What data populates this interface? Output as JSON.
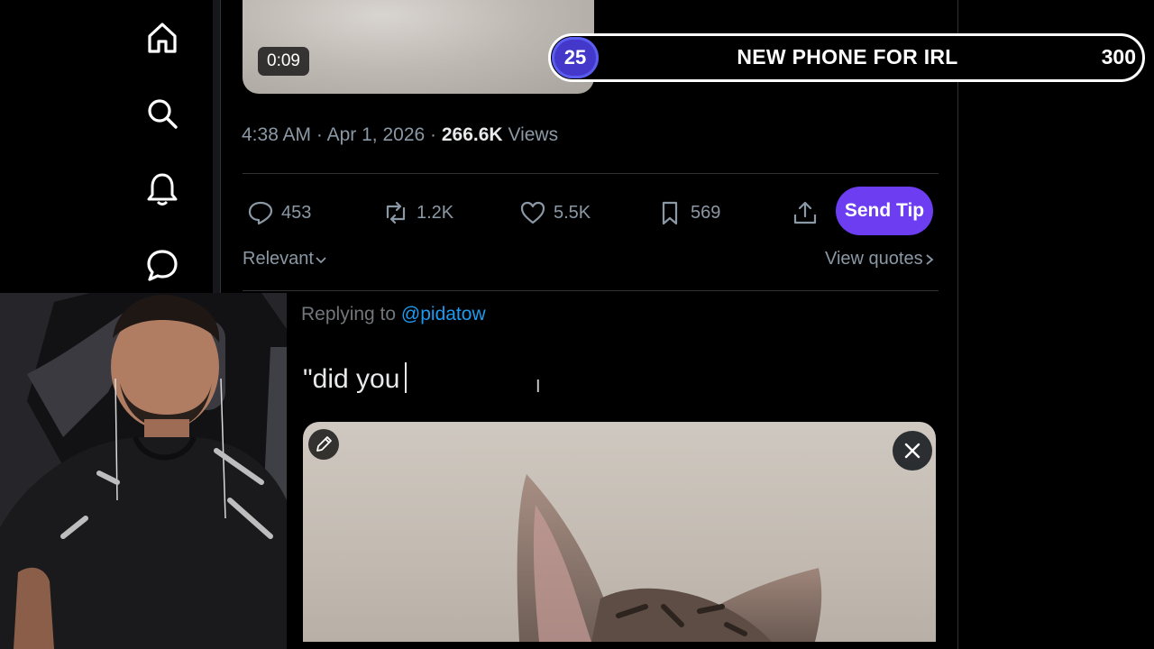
{
  "icons": {
    "home": "home-icon",
    "search": "search-icon",
    "notifications": "bell-icon",
    "messages": "message-icon"
  },
  "video": {
    "duration": "0:09"
  },
  "goal": {
    "count": "25",
    "title": "NEW PHONE FOR IRL",
    "target": "300"
  },
  "tweet": {
    "time": "4:38 AM",
    "date": "Apr 1, 2026",
    "views_count": "266.6K",
    "views_label": "Views",
    "separator": "·"
  },
  "actions": {
    "replies": "453",
    "reposts": "1.2K",
    "likes": "5.5K",
    "bookmarks": "569",
    "send_tip": "Send Tip"
  },
  "replies_section": {
    "sort_label": "Relevant",
    "view_quotes": "View quotes"
  },
  "composer": {
    "replying_to_label": "Replying to",
    "replying_to_handle": "@pidatow",
    "text": "\"did you"
  },
  "colors": {
    "accent_tip": "#6d3df2",
    "link": "#1d9bf0",
    "goal_badge": "#4338ca"
  }
}
